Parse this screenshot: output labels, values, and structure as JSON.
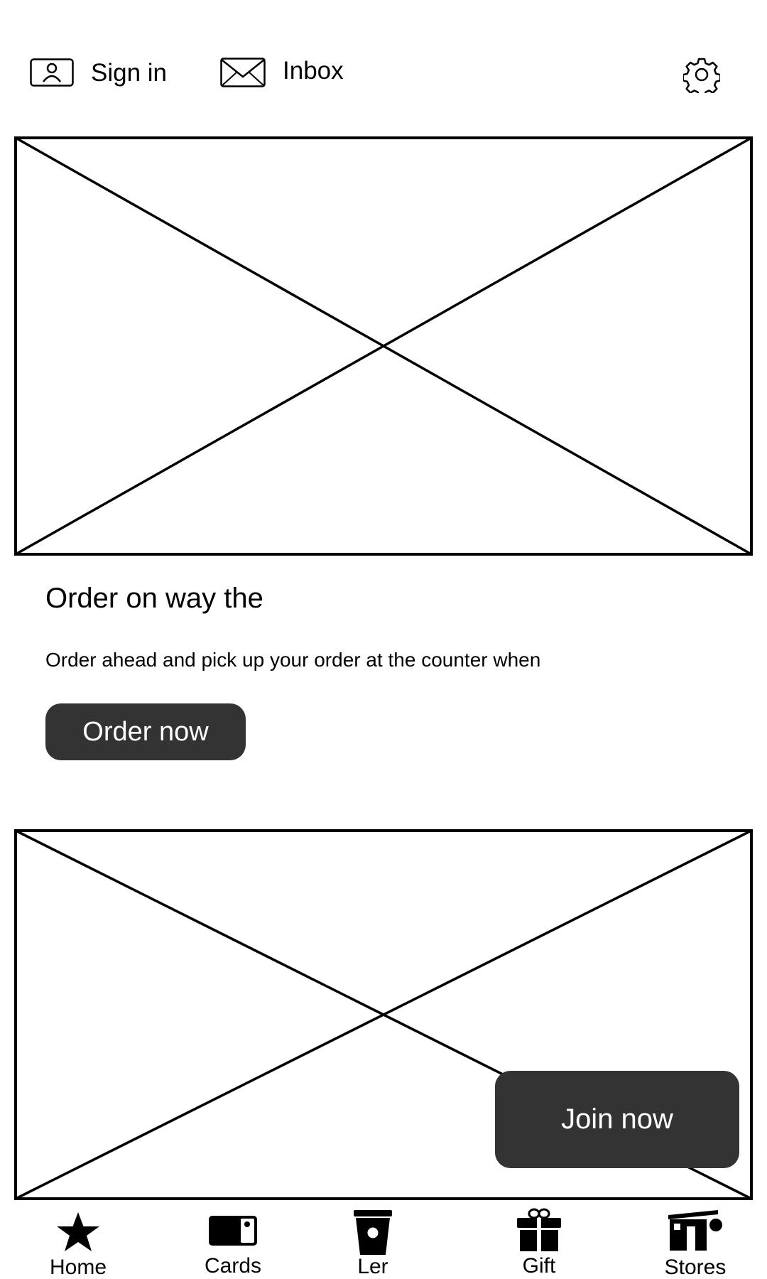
{
  "header": {
    "sign_in_label": "Sign in",
    "inbox_label": "Inbox",
    "icons": [
      "user-card-icon",
      "envelope-icon",
      "gear-icon"
    ]
  },
  "promo": {
    "title": "Order on way the",
    "description": "Order ahead and pick up your order at the counter when",
    "button_label": "Order now"
  },
  "join": {
    "button_label": "Join now"
  },
  "bottom_nav": {
    "items": [
      {
        "label": "Home",
        "icon": "star-icon"
      },
      {
        "label": "Cards",
        "icon": "card-icon"
      },
      {
        "label": "Ler",
        "icon": "cup-icon"
      },
      {
        "label": "Gift",
        "icon": "gift-icon"
      },
      {
        "label": "Stores",
        "icon": "store-icon"
      }
    ]
  },
  "colors": {
    "button_bg": "#333333",
    "button_text": "#ffffff",
    "stroke": "#000000",
    "background": "#ffffff"
  }
}
